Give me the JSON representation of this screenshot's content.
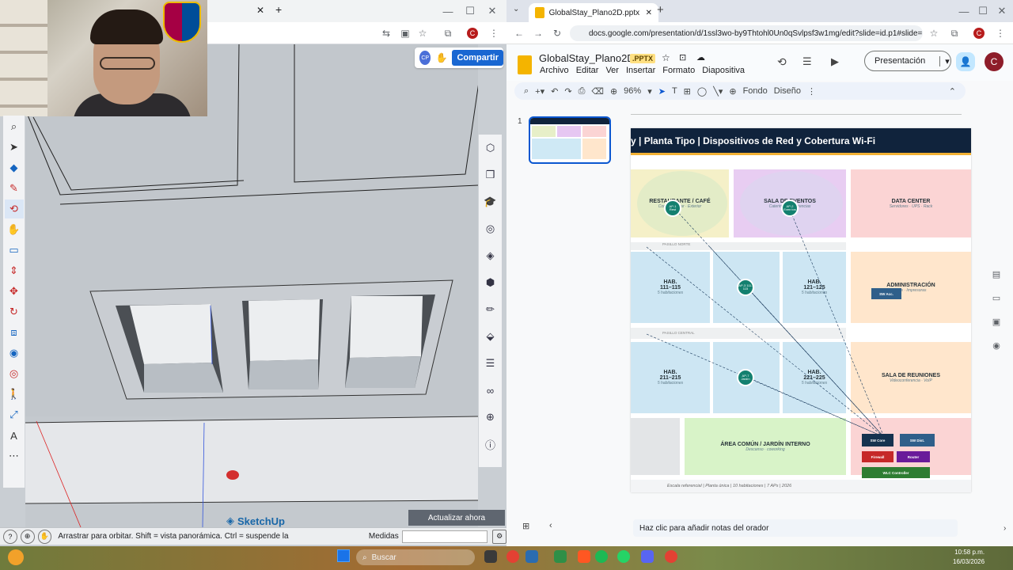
{
  "sketchup": {
    "brand": "SketchUp",
    "share_button": "Compartir",
    "update_button": "Actualizar ahora",
    "status_text": "Arrastrar para orbitar. Shift = vista panorámica. Ctrl = suspende la",
    "measure_label": "Medidas",
    "avatar_initials": "CP"
  },
  "slides_window": {
    "tab_title": "GlobalStay_Plano2D.pptx - Pres",
    "url": "docs.google.com/presentation/d/1ssl3wo-by9Thtohl0Un0qSvlpsf3w1mg/edit?slide=id.p1#slide=i...",
    "doc_title": "GlobalStay_Plano2D",
    "file_badge": ".PPTX",
    "menu": [
      "Archivo",
      "Editar",
      "Ver",
      "Insertar",
      "Formato",
      "Diapositiva"
    ],
    "present_button": "Presentación",
    "user_initial": "C",
    "zoom": "96%",
    "toolbar_background": "Fondo",
    "toolbar_design": "Diseño",
    "slide_number": "1",
    "notes_placeholder": "Haz clic para añadir notas del orador"
  },
  "slide": {
    "title": "y  |  Planta Tipo  |  Dispositivos de Red y Cobertura Wi-Fi",
    "rooms": {
      "restaurant": {
        "name": "RESTAURANTE / CAFÉ",
        "sub": "Comedor · Bar · Exterior"
      },
      "events": {
        "name": "SALA DE EVENTOS",
        "sub": "Catering · Conferencias"
      },
      "datacenter": {
        "name": "DATA CENTER",
        "sub": "Servidores · UPS · Rack"
      },
      "hab1": {
        "name": "HAB.",
        "range": "111–115",
        "sub": "5 habitaciones"
      },
      "hab2": {
        "name": "HAB.",
        "range": "121–125",
        "sub": "5 habitaciones"
      },
      "admin": {
        "name": "ADMINISTRACIÓN",
        "sub": "PCs · Impresoras"
      },
      "hab3": {
        "name": "HAB.",
        "range": "211–215",
        "sub": "5 habitaciones"
      },
      "hab4": {
        "name": "HAB.",
        "range": "221–225",
        "sub": "5 habitaciones"
      },
      "meeting": {
        "name": "SALA DE REUNIONES",
        "sub": "Videoconferencia · VoIP"
      },
      "garden": {
        "name": "ÁREA COMÚN / JARDÍN INTERNO",
        "sub": "Descanso · coworking"
      }
    },
    "hall1": "PASILLO NORTE",
    "hall2": "PASILLO CENTRAL",
    "aps": [
      "AP-1 Rest",
      "AP-2 Even tos",
      "AP-3 111-115",
      "AP-7 Jardín"
    ],
    "devices": {
      "sw_core": "SW Core",
      "sw_dist": "SW Dist.",
      "firewall": "Firewall",
      "router": "Router",
      "wlc": "WLC Controller",
      "sw_acc": "SW Acc."
    },
    "footer": "Escala referencial  |  Planta única  |  10 habitaciones  |  7 APs  |  2026"
  },
  "taskbar": {
    "search_placeholder": "Buscar",
    "time": "10:58 p.m.",
    "date": "16/03/2026"
  },
  "colors": {
    "accent": "#1967d2",
    "slide_header": "#10233c",
    "ap": "#13806f"
  }
}
